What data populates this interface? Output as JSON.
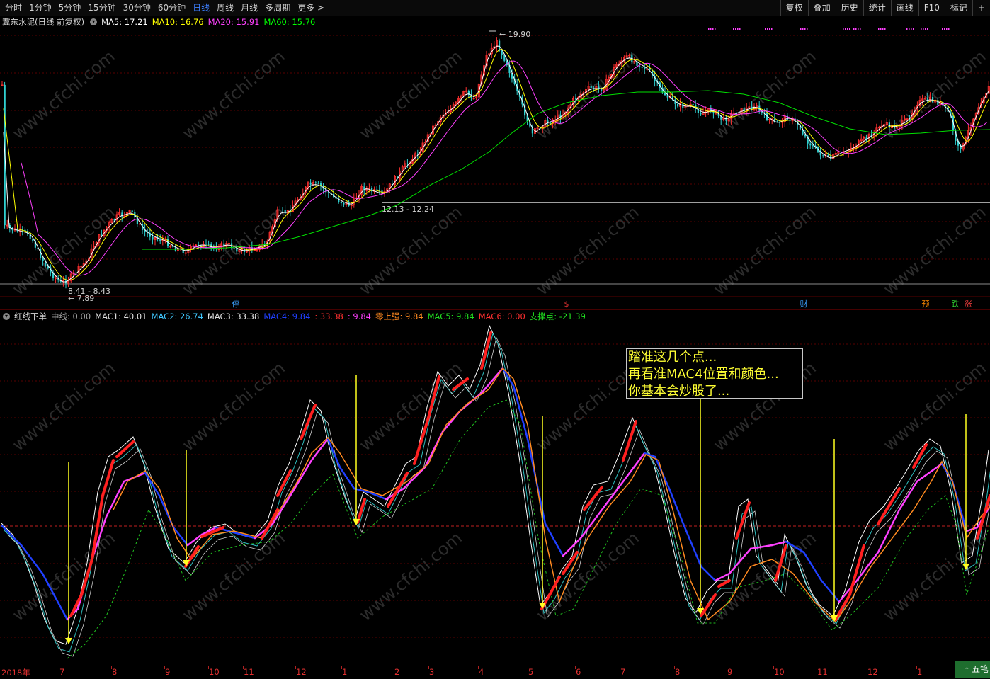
{
  "toolbar": {
    "periods": [
      "分时",
      "1分钟",
      "5分钟",
      "15分钟",
      "30分钟",
      "60分钟",
      "日线",
      "周线",
      "月线",
      "多周期",
      "更多 >"
    ],
    "active_period": "日线",
    "right_buttons": [
      "复权",
      "叠加",
      "历史",
      "统计",
      "画线",
      "F10",
      "标记",
      "+"
    ]
  },
  "price_panel": {
    "title": "冀东水泥(日线 前复权)",
    "ma5": "MA5: 17.21",
    "ma10": "MA10: 16.76",
    "ma20": "MA20: 15.91",
    "ma60": "MA60: 15.76",
    "high_label": "19.90",
    "support_label": "12.13 - 12.24",
    "low_range_label": "8.41 - 8.43",
    "low_label": "7.89",
    "colors": {
      "ma5": "#ffffff",
      "ma10": "#ffff00",
      "ma20": "#ff40ff",
      "ma60": "#00ff00"
    }
  },
  "markers": [
    {
      "text": "停",
      "color": "#3aa0ff"
    },
    {
      "text": "$",
      "color": "#e03030"
    },
    {
      "text": "财",
      "color": "#3aa0ff"
    },
    {
      "text": "预",
      "color": "#ff8a00"
    },
    {
      "text": "跌",
      "color": "#30d030"
    },
    {
      "text": "涨",
      "color": "#ff4040"
    }
  ],
  "indicator_panel": {
    "name": "红线下单",
    "zx": "中线: 0.00",
    "mac1": "MAC1: 40.01",
    "mac2": "MAC2: 26.74",
    "mac3": "MAC3: 33.38",
    "mac4": "MAC4: 9.84",
    "v1": ": 33.38",
    "v2": ": 9.84",
    "lsq": "零上强: 9.84",
    "mac5": "MAC5: 9.84",
    "mac6": "MAC6: 0.00",
    "zcd": "支撑点: -21.39",
    "colors": {
      "mac4_up": "#ff2020",
      "mac4_down": "#2040ff",
      "mac4_rise": "#ff40ff",
      "mac3": "#ff8a20",
      "mac5": "#00c000"
    }
  },
  "annotation": {
    "lines": [
      "踏准这几个点...",
      "再看准MAC4位置和颜色...",
      "你基本会炒股了..."
    ]
  },
  "x_axis": {
    "labels": [
      "2018年",
      "7",
      "8",
      "9",
      "10",
      "11",
      "12",
      "1",
      "2",
      "3",
      "4",
      "5",
      "6",
      "7",
      "8",
      "9",
      "10",
      "11",
      "12",
      "1"
    ]
  },
  "corner_button": "五笔",
  "watermark": "www.cfchi.com"
}
